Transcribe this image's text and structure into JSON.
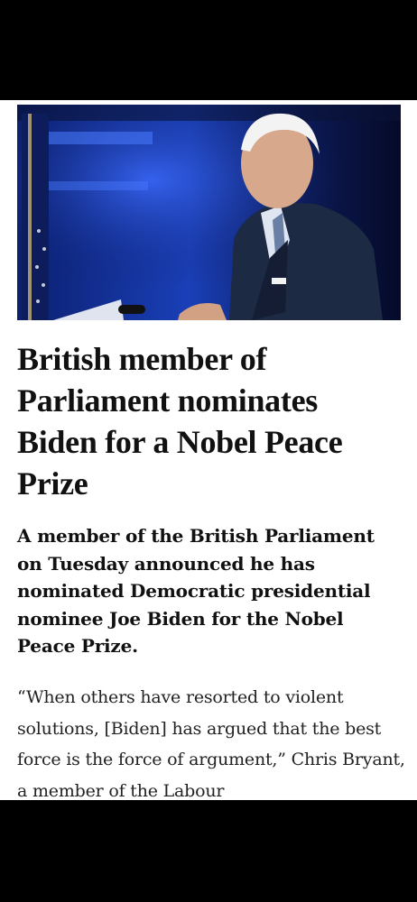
{
  "article": {
    "hero_image": {
      "alt": "Joe Biden speaking at a podium in front of a blue-lit backdrop with an American flag"
    },
    "headline": "British member of Parliament nominates Biden for a Nobel Peace Prize",
    "summary": "A member of the British Parliament on Tuesday announced he has nominated Democratic presidential nominee Joe Biden for the Nobel Peace Prize.",
    "body_paragraph": "“When others have resorted to violent solutions, [Biden] has argued that the best force is the force of argument,” Chris Bryant, a member of the Labour"
  }
}
